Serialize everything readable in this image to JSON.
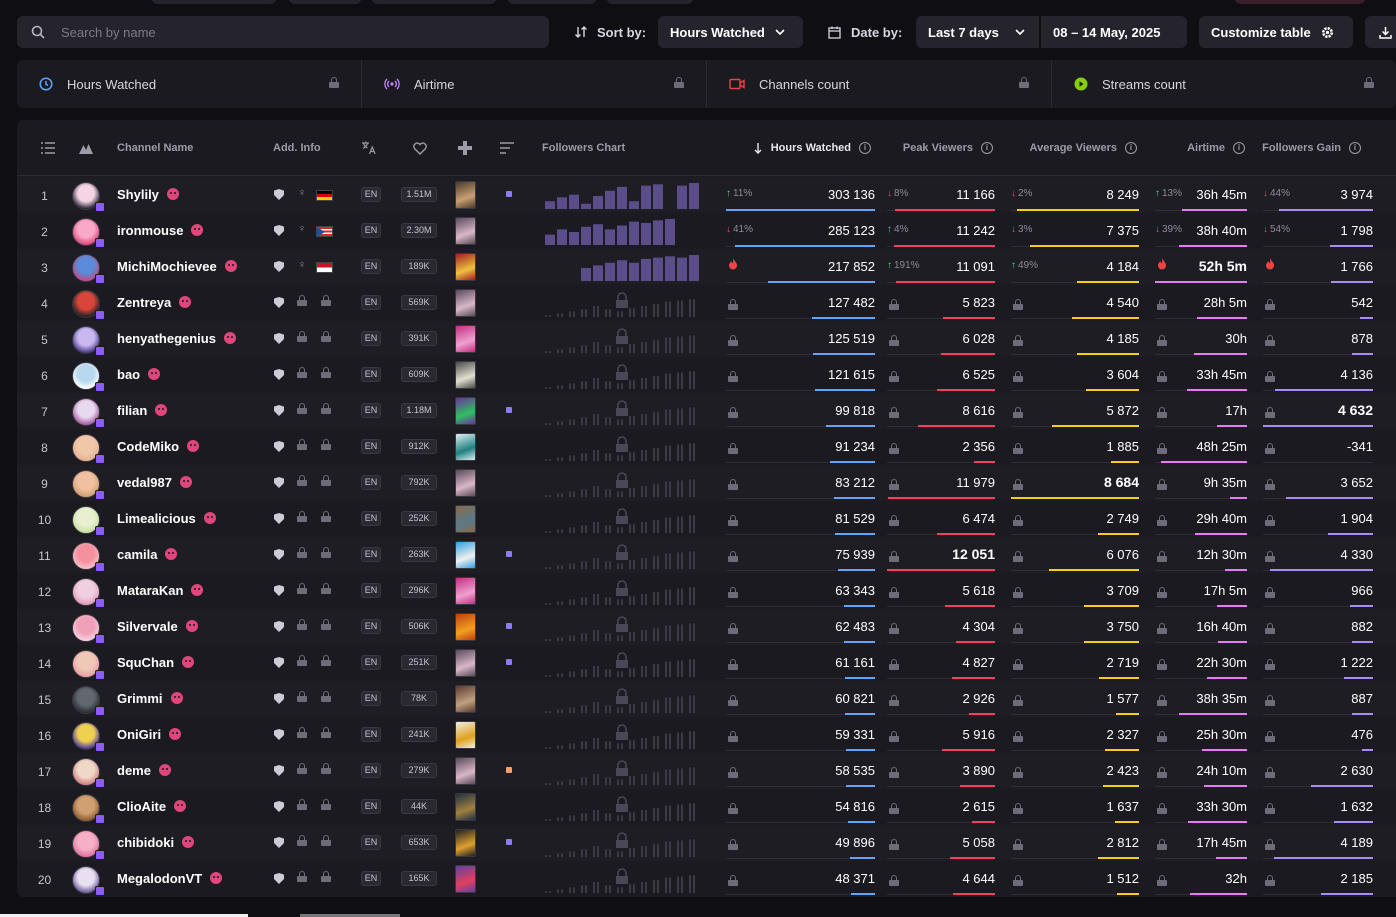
{
  "search": {
    "placeholder": "Search by name"
  },
  "sort": {
    "label": "Sort by:",
    "value": "Hours Watched"
  },
  "date": {
    "label": "Date by:",
    "value": "Last 7 days",
    "range": "08 – 14 May, 2025"
  },
  "customize": {
    "label": "Customize table"
  },
  "metrics": [
    {
      "label": "Hours Watched",
      "icon": "clock-icon",
      "color": "#60a5fa"
    },
    {
      "label": "Airtime",
      "icon": "broadcast-icon",
      "color": "#c084fc"
    },
    {
      "label": "Channels count",
      "icon": "camera-icon",
      "color": "#ef4444"
    },
    {
      "label": "Streams count",
      "icon": "play-icon",
      "color": "#84cc16"
    }
  ],
  "headers": {
    "channel": "Channel Name",
    "addinfo": "Add. Info",
    "chart": "Followers Chart",
    "hours": "Hours Watched",
    "peak": "Peak Viewers",
    "avg": "Average Viewers",
    "airtime": "Airtime",
    "gain": "Followers Gain"
  },
  "colors": {
    "hours": "#60a5fa",
    "peak": "#f43f5e",
    "avg": "#facc15",
    "airtime": "#e879f9",
    "gain": "#a78bfa"
  },
  "rows": [
    {
      "rank": "1",
      "name": "Shylily",
      "flag": "de",
      "followers": "1.51M",
      "dot": "#8b7cf6",
      "hours": "303 136",
      "hours_ch": "11%",
      "hours_up": true,
      "peak": "11 166",
      "peak_ch": "8%",
      "peak_up": false,
      "avg": "8 249",
      "avg_ch": "2%",
      "avg_up": false,
      "air": "36h 45m",
      "air_ch": "13%",
      "air_up": true,
      "gain": "3 974",
      "gain_ch": "44%",
      "gain_up": false,
      "bars": [
        0.3,
        0.45,
        0.55,
        0.2,
        0.5,
        0.7,
        0.85,
        0.3,
        0.9,
        0.95,
        0,
        0.9,
        1
      ]
    },
    {
      "rank": "2",
      "name": "ironmouse",
      "flag": "pr",
      "followers": "2.30M",
      "dot": "",
      "hours": "285 123",
      "hours_ch": "41%",
      "hours_up": false,
      "peak": "11 242",
      "peak_ch": "4%",
      "peak_up": true,
      "avg": "7 375",
      "avg_ch": "3%",
      "avg_up": false,
      "air": "38h 40m",
      "air_ch": "39%",
      "air_up": false,
      "gain": "1 798",
      "gain_ch": "54%",
      "gain_up": false,
      "bars": [
        0.4,
        0.6,
        0.5,
        0.7,
        0.8,
        0.6,
        0.75,
        0.9,
        0.85,
        0.95,
        1,
        0,
        0
      ]
    },
    {
      "rank": "3",
      "name": "MichiMochievee",
      "flag": "id",
      "followers": "189K",
      "dot": "",
      "hours": "217 852",
      "hours_fire": true,
      "peak": "11 091",
      "peak_ch": "191%",
      "peak_up": true,
      "avg": "4 184",
      "avg_ch": "49%",
      "avg_up": true,
      "air": "52h 5m",
      "air_fire": true,
      "air_bold": true,
      "gain": "1 766",
      "gain_fire": true,
      "bars": [
        0,
        0,
        0,
        0.5,
        0.6,
        0.7,
        0.8,
        0.7,
        0.85,
        0.9,
        0.95,
        0.9,
        1
      ]
    },
    {
      "rank": "4",
      "name": "Zentreya",
      "followers": "569K",
      "hours": "127 482",
      "peak": "5 823",
      "avg": "4 540",
      "air": "28h 5m",
      "gain": "542",
      "locked": true
    },
    {
      "rank": "5",
      "name": "henyathegenius",
      "followers": "391K",
      "hours": "125 519",
      "peak": "6 028",
      "avg": "4 185",
      "air": "30h",
      "gain": "878",
      "locked": true
    },
    {
      "rank": "6",
      "name": "bao",
      "followers": "609K",
      "hours": "121 615",
      "peak": "6 525",
      "avg": "3 604",
      "air": "33h 45m",
      "gain": "4 136",
      "locked": true
    },
    {
      "rank": "7",
      "name": "filian",
      "followers": "1.18M",
      "dot": "#8b7cf6",
      "hours": "99 818",
      "peak": "8 616",
      "avg": "5 872",
      "air": "17h",
      "gain": "4 632",
      "gain_bold": true,
      "locked": true
    },
    {
      "rank": "8",
      "name": "CodeMiko",
      "followers": "912K",
      "hours": "91 234",
      "peak": "2 356",
      "avg": "1 885",
      "air": "48h 25m",
      "gain": "-341",
      "locked": true
    },
    {
      "rank": "9",
      "name": "vedal987",
      "followers": "792K",
      "hours": "83 212",
      "peak": "11 979",
      "avg": "8 684",
      "avg_bold": true,
      "air": "9h 35m",
      "gain": "3 652",
      "locked": true
    },
    {
      "rank": "10",
      "name": "Limealicious",
      "followers": "252K",
      "hours": "81 529",
      "peak": "6 474",
      "avg": "2 749",
      "air": "29h 40m",
      "gain": "1 904",
      "locked": true
    },
    {
      "rank": "11",
      "name": "camila",
      "followers": "263K",
      "dot": "#8b7cf6",
      "hours": "75 939",
      "peak": "12 051",
      "peak_bold": true,
      "avg": "6 076",
      "air": "12h 30m",
      "gain": "4 330",
      "locked": true
    },
    {
      "rank": "12",
      "name": "MataraKan",
      "followers": "296K",
      "hours": "63 343",
      "peak": "5 618",
      "avg": "3 709",
      "air": "17h 5m",
      "gain": "966",
      "locked": true
    },
    {
      "rank": "13",
      "name": "Silvervale",
      "followers": "506K",
      "dot": "#8b7cf6",
      "hours": "62 483",
      "peak": "4 304",
      "avg": "3 750",
      "air": "16h 40m",
      "gain": "882",
      "locked": true
    },
    {
      "rank": "14",
      "name": "SquChan",
      "followers": "251K",
      "dot": "#8b7cf6",
      "hours": "61 161",
      "peak": "4 827",
      "avg": "2 719",
      "air": "22h 30m",
      "gain": "1 222",
      "locked": true
    },
    {
      "rank": "15",
      "name": "Grimmi",
      "followers": "78K",
      "hours": "60 821",
      "peak": "2 926",
      "avg": "1 577",
      "air": "38h 35m",
      "gain": "887",
      "locked": true
    },
    {
      "rank": "16",
      "name": "OniGiri",
      "followers": "241K",
      "hours": "59 331",
      "peak": "5 916",
      "avg": "2 327",
      "air": "25h 30m",
      "gain": "476",
      "locked": true
    },
    {
      "rank": "17",
      "name": "deme",
      "followers": "279K",
      "dot": "#f59e6b",
      "hours": "58 535",
      "peak": "3 890",
      "avg": "2 423",
      "air": "24h 10m",
      "gain": "2 630",
      "locked": true
    },
    {
      "rank": "18",
      "name": "ClioAite",
      "followers": "44K",
      "hours": "54 816",
      "peak": "2 615",
      "avg": "1 637",
      "air": "33h 30m",
      "gain": "1 632",
      "locked": true
    },
    {
      "rank": "19",
      "name": "chibidoki",
      "followers": "653K",
      "dot": "#8b7cf6",
      "hours": "49 896",
      "peak": "5 058",
      "avg": "2 812",
      "air": "17h 45m",
      "gain": "4 189",
      "locked": true
    },
    {
      "rank": "20",
      "name": "MegalodonVT",
      "followers": "165K",
      "hours": "48 371",
      "peak": "4 644",
      "avg": "1 512",
      "air": "32h",
      "gain": "2 185",
      "locked": true
    }
  ],
  "lang": "EN"
}
